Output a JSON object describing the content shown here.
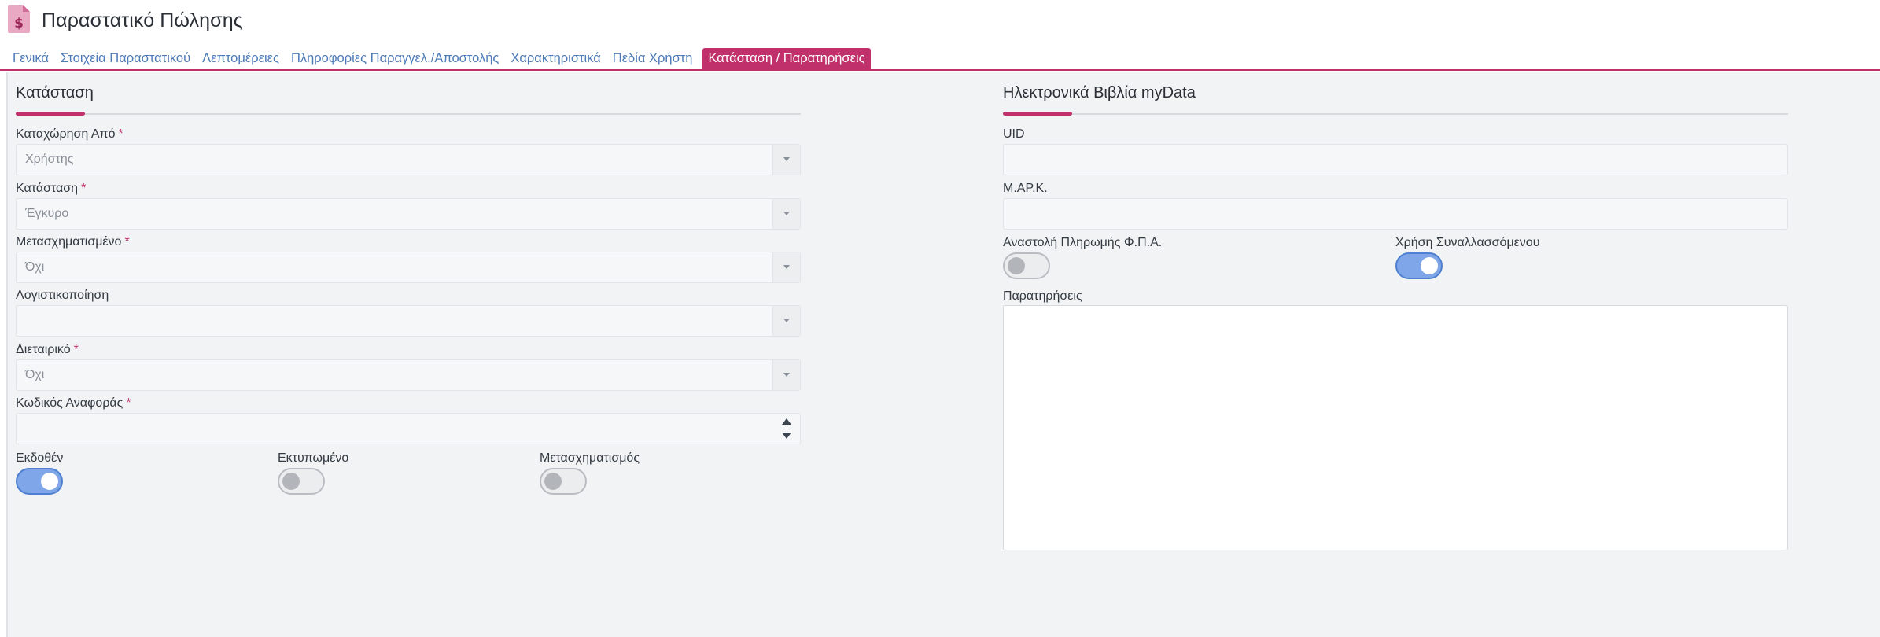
{
  "header": {
    "title": "Παραστατικό Πώλησης",
    "icon": "invoice-dollar-icon",
    "accent_color": "#c0306a"
  },
  "tabs": [
    {
      "label": "Γενικά"
    },
    {
      "label": "Στοιχεία Παραστατικού"
    },
    {
      "label": "Λεπτομέρειες"
    },
    {
      "label": "Πληροφορίες Παραγγελ./Αποστολής"
    },
    {
      "label": "Χαρακτηριστικά"
    },
    {
      "label": "Πεδία Χρήστη"
    },
    {
      "label": "Κατάσταση / Παρατηρήσεις",
      "active": true
    }
  ],
  "status_section": {
    "title": "Κατάσταση",
    "fields": {
      "registered_by": {
        "label": "Καταχώρηση Από",
        "required_mark": "*",
        "value": "Χρήστης"
      },
      "status": {
        "label": "Κατάσταση",
        "required_mark": "*",
        "value": "Έγκυρο"
      },
      "transformed": {
        "label": "Μετασχηματισμένο",
        "required_mark": "*",
        "value": "Όχι"
      },
      "accounting": {
        "label": "Λογιστικοποίηση",
        "value": ""
      },
      "intercompany": {
        "label": "Διεταιρικό",
        "required_mark": "*",
        "value": "Όχι"
      },
      "reference_code": {
        "label": "Κωδικός Αναφοράς",
        "required_mark": "*",
        "value": ""
      }
    },
    "toggles": {
      "issued": {
        "label": "Εκδοθέν",
        "on": true
      },
      "printed": {
        "label": "Εκτυπωμένο",
        "on": false
      },
      "transformation": {
        "label": "Μετασχηματισμός",
        "on": false
      }
    }
  },
  "mydata_section": {
    "title": "Ηλεκτρονικά Βιβλία myData",
    "fields": {
      "uid": {
        "label": "UID",
        "value": ""
      },
      "mark": {
        "label": "Μ.ΑΡ.Κ.",
        "value": ""
      },
      "notes": {
        "label": "Παρατηρήσεις",
        "value": ""
      }
    },
    "toggles": {
      "vat_suspension": {
        "label": "Αναστολή Πληρωμής Φ.Π.Α.",
        "on": false
      },
      "use_counterparty": {
        "label": "Χρήση Συναλλασσόμενου",
        "on": true
      }
    }
  }
}
